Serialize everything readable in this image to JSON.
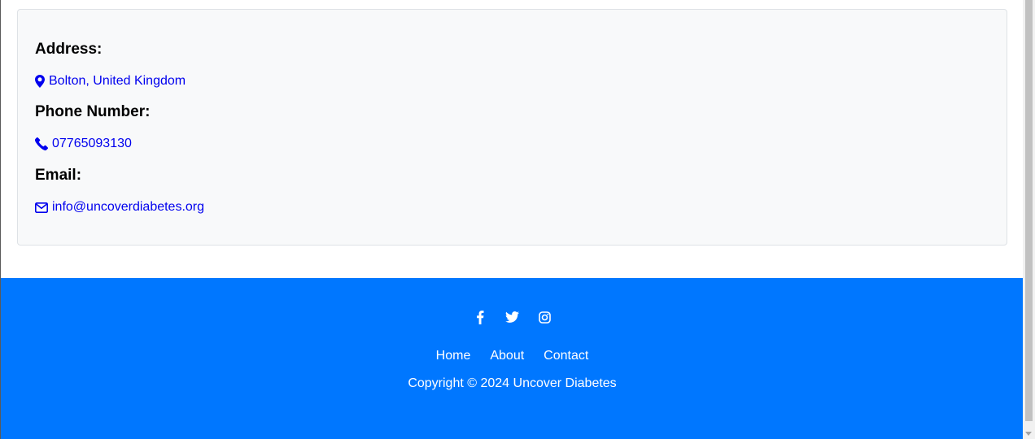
{
  "contact": {
    "address_heading": "Address:",
    "address_value": "Bolton, United Kingdom",
    "phone_heading": "Phone Number:",
    "phone_value": "07765093130",
    "email_heading": "Email:",
    "email_value": "info@uncoverdiabetes.org",
    "icons": {
      "address": "map-marker-icon",
      "phone": "phone-icon",
      "email": "envelope-icon"
    }
  },
  "footer": {
    "social": [
      "facebook-icon",
      "twitter-icon",
      "instagram-icon"
    ],
    "nav": {
      "home": "Home",
      "about": "About",
      "contact": "Contact"
    },
    "copyright": "Copyright © 2024 Uncover Diabetes"
  },
  "colors": {
    "footer_background": "#0077ff",
    "link": "#0000ee",
    "card_background": "#f8f9fa"
  }
}
